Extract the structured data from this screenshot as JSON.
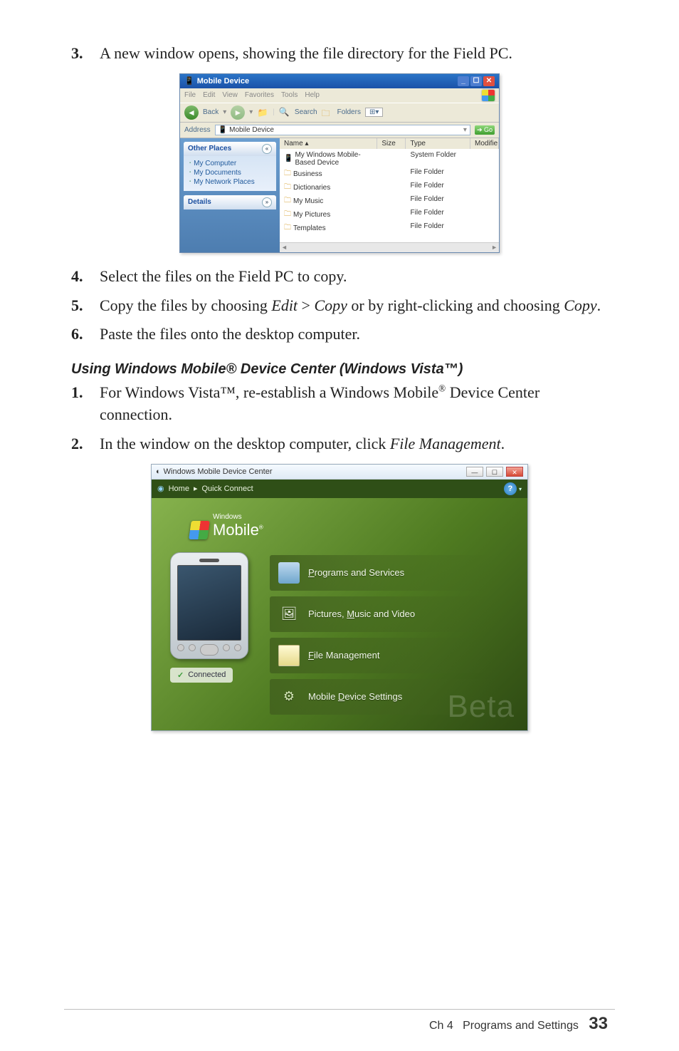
{
  "steps_a": [
    {
      "n": "3.",
      "text": "A new window opens, showing the file directory for the Field PC."
    },
    {
      "n": "4.",
      "text": "Select the files on the Field PC to copy."
    },
    {
      "n": "5.",
      "before": "Copy the files by choosing ",
      "em1": "Edit",
      "mid": " > ",
      "em2": "Copy",
      "mid2": " or by right-clicking and choosing ",
      "em3": "Copy",
      "after": "."
    },
    {
      "n": "6.",
      "text": "Paste the files onto the desktop computer."
    }
  ],
  "subheading": "Using Windows Mobile® Device Center (Windows Vista™)",
  "steps_b": [
    {
      "n": "1.",
      "before": "For Windows Vista™, re-establish a Windows Mobile",
      "sup": "®",
      "after": " Device Center connection."
    },
    {
      "n": "2.",
      "before": "In the window on the desktop computer, click ",
      "em": "File Management",
      "after": "."
    }
  ],
  "explorer": {
    "title": "Mobile Device",
    "menu": [
      "File",
      "Edit",
      "View",
      "Favorites",
      "Tools",
      "Help"
    ],
    "toolbar": {
      "back": "Back",
      "search": "Search",
      "folders": "Folders"
    },
    "address_label": "Address",
    "address_value": "Mobile Device",
    "go": "Go",
    "side": {
      "other": {
        "title": "Other Places",
        "items": [
          "My Computer",
          "My Documents",
          "My Network Places"
        ]
      },
      "details": {
        "title": "Details"
      }
    },
    "cols": {
      "name": "Name  ▴",
      "size": "Size",
      "type": "Type",
      "mod": "Modifie"
    },
    "rows": [
      {
        "name": "My Windows Mobile-Based Device",
        "type": "System Folder",
        "ico": "fi-sys"
      },
      {
        "name": "Business",
        "type": "File Folder",
        "ico": "fi"
      },
      {
        "name": "Dictionaries",
        "type": "File Folder",
        "ico": "fi"
      },
      {
        "name": "My Music",
        "type": "File Folder",
        "ico": "fi"
      },
      {
        "name": "My Pictures",
        "type": "File Folder",
        "ico": "fi"
      },
      {
        "name": "Templates",
        "type": "File Folder",
        "ico": "fi"
      }
    ]
  },
  "wmdc": {
    "title": "Windows Mobile Device Center",
    "bar_home": "Home",
    "bar_sep": "▸",
    "bar_quick": "Quick Connect",
    "logo_small": "Windows",
    "logo_main": "Mobile",
    "items": [
      {
        "pre": "P",
        "label": "rograms and Services",
        "ico": "ico-prog"
      },
      {
        "pre": "",
        "mid_plain": "Pictures, ",
        "u": "M",
        "tail": "usic and Video",
        "ico": "ico-pic"
      },
      {
        "u": "F",
        "tail": "ile Management",
        "ico": "ico-file"
      },
      {
        "pre": "Mobile ",
        "u": "D",
        "tail": "evice Settings",
        "ico": "ico-set"
      }
    ],
    "connected": "Connected",
    "beta": "Beta"
  },
  "footer": {
    "ch": "Ch 4",
    "title": "Programs and Settings",
    "page": "33"
  }
}
